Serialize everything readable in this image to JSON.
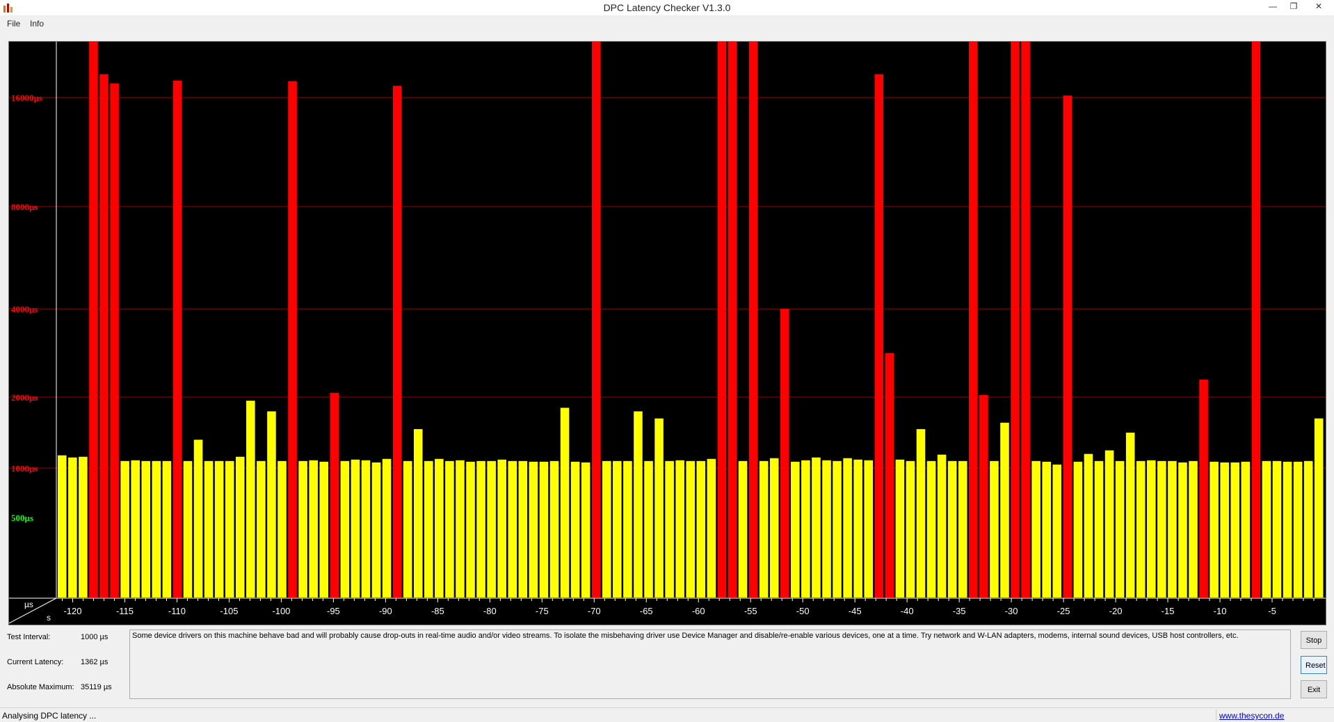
{
  "window": {
    "title": "DPC Latency Checker V1.3.0"
  },
  "menu": {
    "file": "File",
    "info": "Info"
  },
  "colors": {
    "normal": "#ffff00",
    "high": "#ff0000",
    "grid": "#a00000",
    "background": "#000000"
  },
  "chart_data": {
    "type": "bar",
    "y_scale": "nonlinear",
    "y_ticks": [
      {
        "value": 500,
        "label": "500µs",
        "color": "#00ff00"
      },
      {
        "value": 1000,
        "label": "1000µs",
        "color": "#ff0000"
      },
      {
        "value": 2000,
        "label": "2000µs",
        "color": "#ff0000"
      },
      {
        "value": 4000,
        "label": "4000µs",
        "color": "#ff0000"
      },
      {
        "value": 8000,
        "label": "8000µs",
        "color": "#ff0000"
      },
      {
        "value": 16000,
        "label": "16000µs",
        "color": "#ff0000"
      }
    ],
    "x_label": "s",
    "y_label": "µs",
    "x_ticks": [
      "-120",
      "-115",
      "-110",
      "-105",
      "-100",
      "-95",
      "-90",
      "-85",
      "-80",
      "-75",
      "-70",
      "-65",
      "-60",
      "-55",
      "-50",
      "-45",
      "-40",
      "-35",
      "-30",
      "-25",
      "-20",
      "-15",
      "-10",
      "-5"
    ],
    "x_range": [
      -121.5,
      0
    ],
    "high_threshold": 2000,
    "values": [
      1180,
      1150,
      1160,
      35000,
      21000,
      19000,
      1100,
      1110,
      1100,
      1100,
      1100,
      19600,
      1100,
      1400,
      1100,
      1100,
      1100,
      1160,
      1950,
      1100,
      1800,
      1100,
      19500,
      1100,
      1110,
      1090,
      2100,
      1100,
      1120,
      1110,
      1080,
      1130,
      18500,
      1100,
      1550,
      1100,
      1130,
      1100,
      1110,
      1090,
      1100,
      1100,
      1120,
      1100,
      1100,
      1090,
      1090,
      1100,
      1850,
      1090,
      1080,
      35000,
      1100,
      1100,
      1100,
      1800,
      1100,
      1700,
      1100,
      1110,
      1100,
      1100,
      1130,
      35000,
      35000,
      1100,
      35000,
      1100,
      1140,
      4000,
      1090,
      1110,
      1150,
      1110,
      1100,
      1140,
      1120,
      1110,
      21000,
      3000,
      1120,
      1100,
      1550,
      1100,
      1190,
      1100,
      1100,
      35000,
      2050,
      1100,
      1640,
      35000,
      35000,
      1100,
      1090,
      1050,
      16400,
      1090,
      1200,
      1100,
      1250,
      1100,
      1500,
      1100,
      1110,
      1100,
      1100,
      1080,
      1100,
      2400,
      1090,
      1080,
      1080,
      1090,
      35000,
      1100,
      1100,
      1090,
      1090,
      1100,
      1700
    ]
  },
  "info": {
    "test_interval_label": "Test Interval:",
    "test_interval_value": "1000 µs",
    "current_latency_label": "Current Latency:",
    "current_latency_value": "1362 µs",
    "absolute_max_label": "Absolute Maximum:",
    "absolute_max_value": "35119 µs"
  },
  "message": "Some device drivers on this machine behave bad and will probably cause drop-outs in real-time audio and/or video streams. To isolate the misbehaving driver use Device Manager and disable/re-enable various devices, one at a time. Try network and W-LAN adapters, modems, internal sound devices, USB host controllers, etc.",
  "buttons": {
    "stop": "Stop",
    "reset": "Reset",
    "exit": "Exit"
  },
  "status": {
    "text": "Analysing DPC latency ...",
    "link": "www.thesycon.de"
  }
}
